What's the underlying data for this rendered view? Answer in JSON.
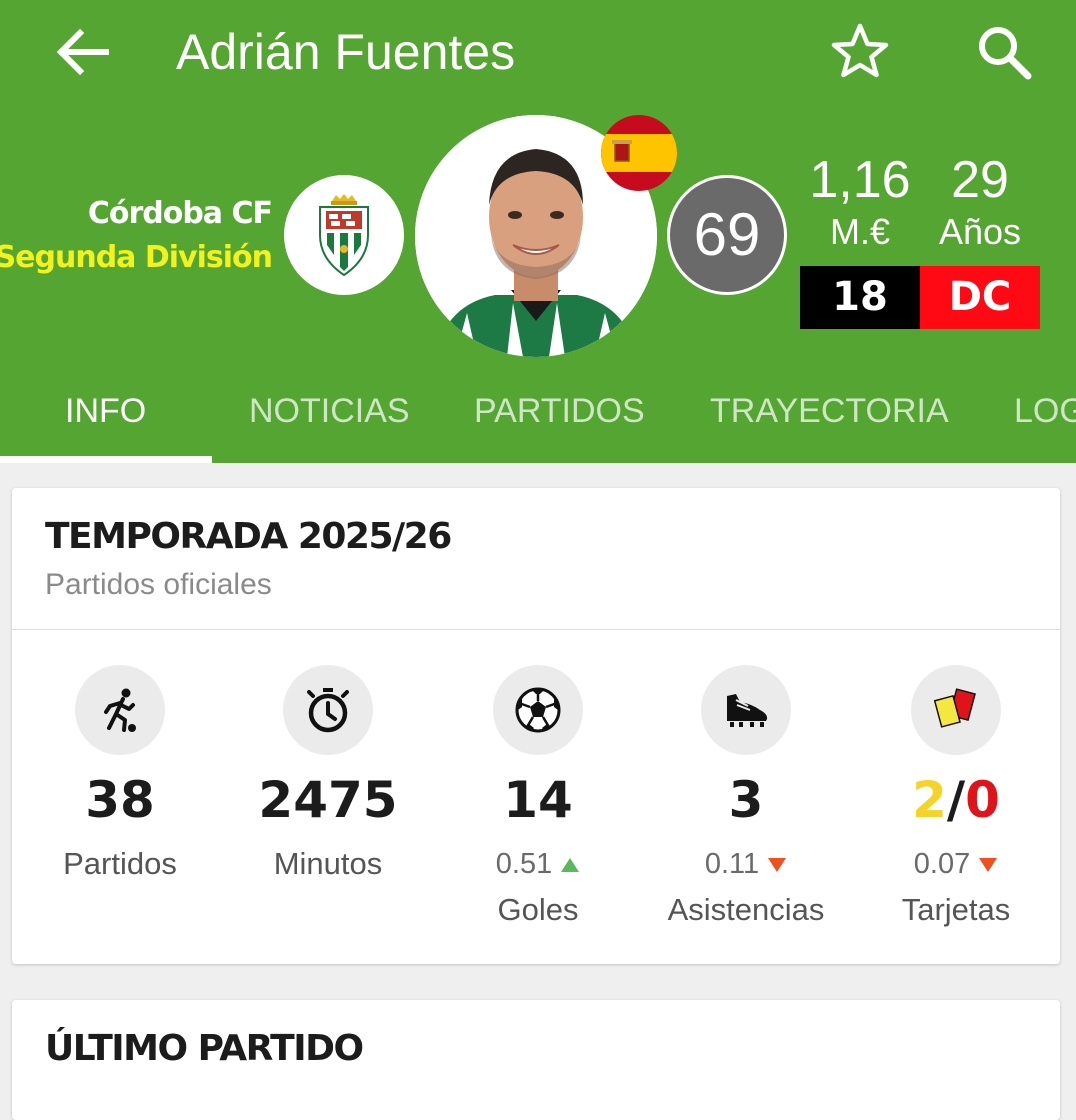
{
  "header": {
    "title": "Adrián Fuentes",
    "club": "Córdoba CF",
    "league": "Segunda División",
    "rating": "69",
    "market_value": "1,16",
    "market_value_unit": "M.€",
    "age": "29",
    "age_unit": "Años",
    "jersey_number": "18",
    "position": "DC",
    "nationality_flag": "spain-flag"
  },
  "tabs": [
    {
      "label": "INFO",
      "active": true
    },
    {
      "label": "NOTICIAS"
    },
    {
      "label": "PARTIDOS"
    },
    {
      "label": "TRAYECTORIA"
    },
    {
      "label": "LOG"
    }
  ],
  "season": {
    "title": "TEMPORADA 2025/26",
    "subtitle": "Partidos oficiales",
    "stats": [
      {
        "icon": "player-running-icon",
        "value": "38",
        "label": "Partidos"
      },
      {
        "icon": "stopwatch-icon",
        "value": "2475",
        "label": "Minutos"
      },
      {
        "icon": "soccer-ball-icon",
        "value": "14",
        "avg": "0.51",
        "trend": "up",
        "label": "Goles"
      },
      {
        "icon": "football-boot-icon",
        "value": "3",
        "avg": "0.11",
        "trend": "down",
        "label": "Asistencias"
      },
      {
        "icon": "cards-icon",
        "yellow": "2",
        "separator": "/",
        "red": "0",
        "avg": "0.07",
        "trend": "down",
        "label": "Tarjetas"
      }
    ]
  },
  "last_match": {
    "title": "ÚLTIMO PARTIDO"
  },
  "colors": {
    "header_green": "#55a532",
    "league_yellow": "#f3f21c",
    "position_red": "#ff0a14",
    "trend_up": "#5cb85c",
    "trend_down": "#f0501e",
    "yellow_card": "#f5d327",
    "red_card": "#e0131a"
  }
}
